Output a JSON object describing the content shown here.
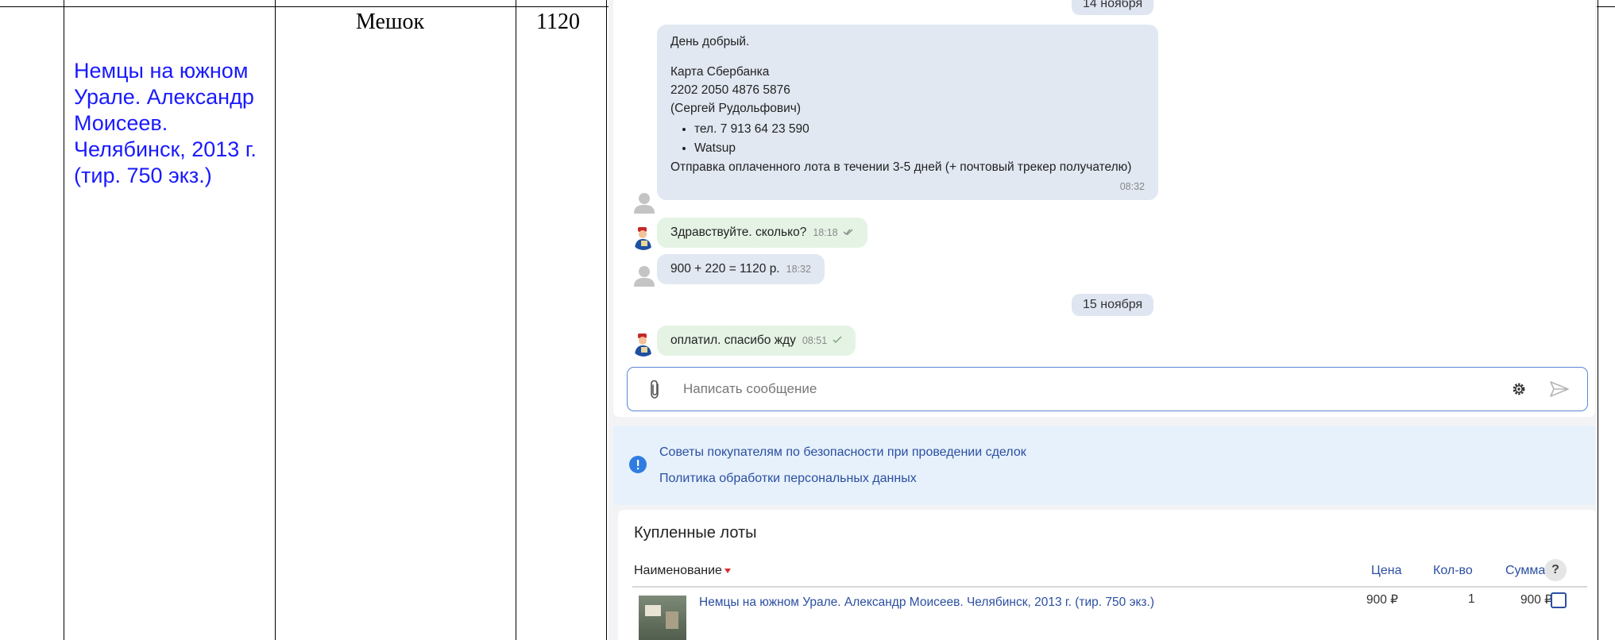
{
  "table_cells": {
    "book_title": "Немцы на южном Урале. Александр Моисеев. Челябинск, 2013 г. (тир. 750 экз.)",
    "packaging": "Мешок",
    "amount": "1120"
  },
  "chat": {
    "date_top": "14 ноября",
    "message_payment": {
      "greeting": "День добрый.",
      "card_label": "Карта Сбербанка",
      "card_number": "2202 2050 4876 5876",
      "card_holder": "(Сергей Рудольфович)",
      "contacts": [
        "тел. 7 913 64 23 590",
        "Watsup"
      ],
      "shipping_note": "Отправка оплаченного лота в течении 3-5 дней (+ почтовый трекер получателю)",
      "time": "08:32"
    },
    "message_question": {
      "text": "Здравствуйте. сколько?",
      "time": "18:18",
      "status_icon": "double-check-icon"
    },
    "message_price": {
      "text": "900 + 220 = 1120 р.",
      "time": "18:32"
    },
    "date_second": "15 ноября",
    "message_paid": {
      "text": "оплатил. спасибо жду",
      "time": "08:51",
      "status_icon": "check-icon"
    },
    "composer": {
      "placeholder": "Написать сообщение"
    }
  },
  "info": {
    "icon": "info-icon",
    "links": [
      "Советы покупателям по безопасности при проведении сделок",
      "Политика обработки персональных данных"
    ]
  },
  "purchased_lots": {
    "title": "Купленные лоты",
    "columns": {
      "name": "Наименование",
      "price": "Цена",
      "qty": "Кол-во",
      "sum": "Сумма",
      "help": "?"
    },
    "rows": [
      {
        "name": "Немцы на южном Урале. Александр Моисеев. Челябинск, 2013 г. (тир. 750 экз.)",
        "price": "900 ₽",
        "qty": "1",
        "sum": "900 ₽"
      }
    ]
  },
  "colors": {
    "link_blue": "#1a1aff",
    "accent_blue": "#2b4fa1",
    "incoming_bubble": "#e1e8f2",
    "outgoing_bubble": "#e5f3e5",
    "info_bg": "#e7f1fb",
    "sort_red": "#d32f2f"
  }
}
